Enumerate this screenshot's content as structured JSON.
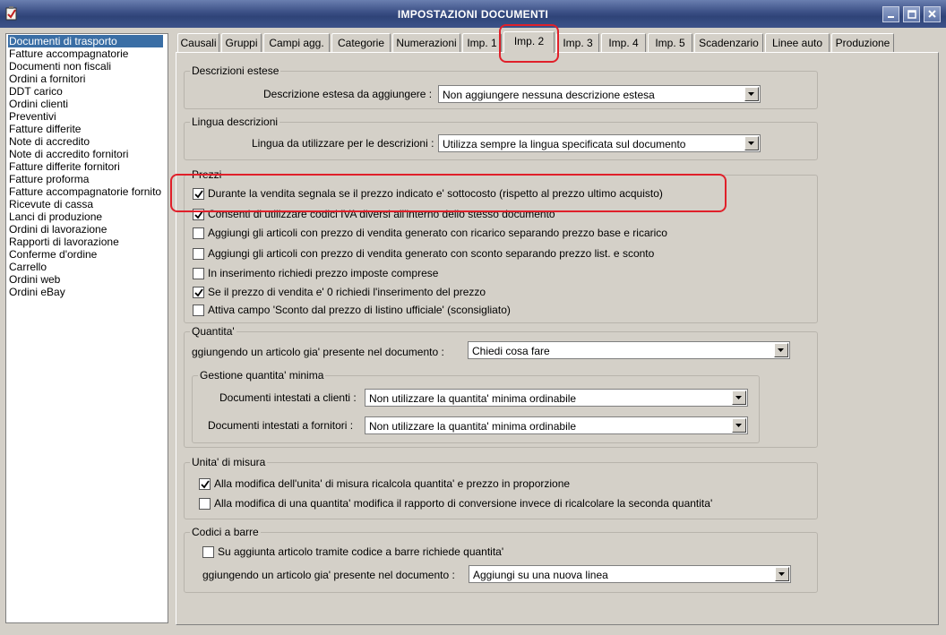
{
  "window": {
    "title": "IMPOSTAZIONI DOCUMENTI"
  },
  "sidebar": {
    "items": [
      {
        "label": "Documenti di trasporto",
        "selected": true
      },
      {
        "label": "Fatture accompagnatorie"
      },
      {
        "label": "Documenti non fiscali"
      },
      {
        "label": "Ordini a fornitori"
      },
      {
        "label": "DDT carico"
      },
      {
        "label": "Ordini clienti"
      },
      {
        "label": "Preventivi"
      },
      {
        "label": "Fatture differite"
      },
      {
        "label": "Note di accredito"
      },
      {
        "label": "Note di accredito fornitori"
      },
      {
        "label": "Fatture differite fornitori"
      },
      {
        "label": "Fatture proforma"
      },
      {
        "label": "Fatture accompagnatorie fornito"
      },
      {
        "label": "Ricevute di cassa"
      },
      {
        "label": "Lanci di produzione"
      },
      {
        "label": "Ordini di lavorazione"
      },
      {
        "label": "Rapporti di lavorazione"
      },
      {
        "label": "Conferme d'ordine"
      },
      {
        "label": "Carrello"
      },
      {
        "label": "Ordini web"
      },
      {
        "label": "Ordini eBay"
      }
    ]
  },
  "tabs": [
    {
      "label": "Causali"
    },
    {
      "label": "Gruppi"
    },
    {
      "label": "Campi agg."
    },
    {
      "label": "Categorie"
    },
    {
      "label": "Numerazioni"
    },
    {
      "label": "Imp. 1"
    },
    {
      "label": "Imp. 2",
      "active": true
    },
    {
      "label": "Imp. 3"
    },
    {
      "label": "Imp. 4"
    },
    {
      "label": "Imp. 5"
    },
    {
      "label": "Scadenzario"
    },
    {
      "label": "Linee auto"
    },
    {
      "label": "Produzione"
    }
  ],
  "descrizioni": {
    "legend": "Descrizioni estese",
    "label": "Descrizione estesa da aggiungere :",
    "value": "Non aggiungere nessuna descrizione estesa"
  },
  "lingua": {
    "legend": "Lingua descrizioni",
    "label": "Lingua da utilizzare per le descrizioni :",
    "value": "Utilizza sempre la lingua specificata sul documento"
  },
  "prezzi": {
    "legend": "Prezzi",
    "options": [
      {
        "label": "Durante la vendita segnala se il prezzo indicato e' sottocosto (rispetto al prezzo ultimo acquisto)",
        "checked": true
      },
      {
        "label": "Consenti di utilizzare codici IVA diversi all'interno dello stesso documento",
        "checked": true
      },
      {
        "label": "Aggiungi gli articoli con prezzo di vendita generato con ricarico separando prezzo base e ricarico",
        "checked": false
      },
      {
        "label": "Aggiungi gli articoli con prezzo di vendita generato con sconto separando prezzo list. e sconto",
        "checked": false
      },
      {
        "label": "In inserimento richiedi prezzo imposte comprese",
        "checked": false
      },
      {
        "label": "Se il prezzo di vendita e' 0 richiedi l'inserimento del prezzo",
        "checked": true
      },
      {
        "label": "Attiva campo 'Sconto dal prezzo di listino ufficiale' (sconsigliato)",
        "checked": false
      }
    ]
  },
  "quantita": {
    "legend": "Quantita'",
    "label": "ggiungendo un articolo gia' presente nel documento :",
    "value": "Chiedi cosa fare",
    "minima": {
      "legend": "Gestione quantita' minima",
      "clienti_label": "Documenti intestati a clienti :",
      "clienti_value": "Non utilizzare la quantita' minima ordinabile",
      "fornitori_label": "Documenti intestati a fornitori :",
      "fornitori_value": "Non utilizzare la quantita' minima ordinabile"
    }
  },
  "unita": {
    "legend": "Unita' di misura",
    "options": [
      {
        "label": "Alla modifica dell'unita' di misura ricalcola quantita' e prezzo in proporzione",
        "checked": true
      },
      {
        "label": "Alla modifica di una quantita' modifica il rapporto di conversione invece di ricalcolare la seconda quantita'",
        "checked": false
      }
    ]
  },
  "barre": {
    "legend": "Codici a barre",
    "option": {
      "label": "Su aggiunta articolo tramite codice a barre richiede quantita'",
      "checked": false
    },
    "label": "ggiungendo un articolo gia' presente nel documento :",
    "value": "Aggiungi su una nuova linea"
  },
  "colors": {
    "highlight": "#e0202a",
    "selection": "#3a6ea5",
    "titlebar": "#3a4e84"
  }
}
